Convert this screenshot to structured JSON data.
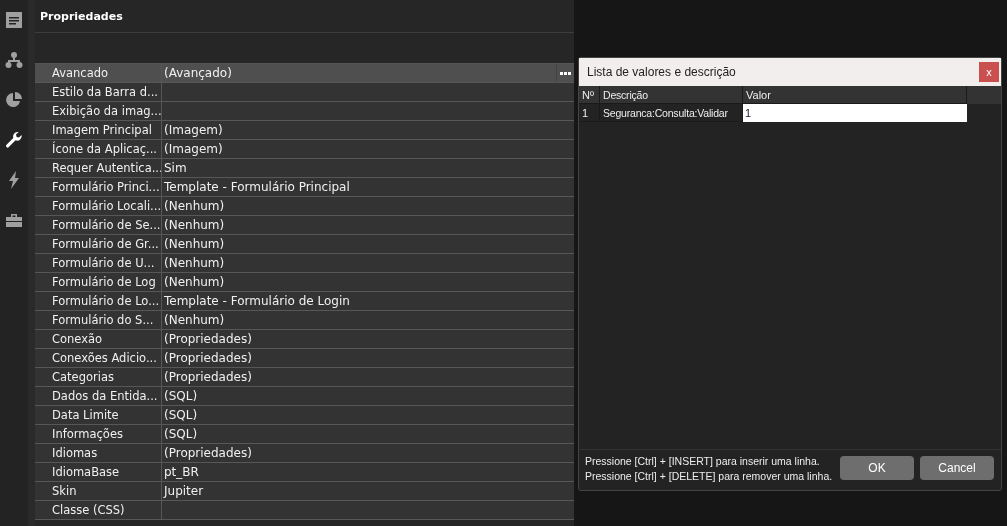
{
  "sidebar": {
    "items": [
      {
        "kind": "form",
        "selected": false
      },
      {
        "kind": "hierarchy",
        "selected": false
      },
      {
        "kind": "chart",
        "selected": false
      },
      {
        "kind": "wrench",
        "selected": true
      },
      {
        "kind": "lightning",
        "selected": false
      },
      {
        "kind": "toolbox",
        "selected": false
      }
    ]
  },
  "properties": {
    "title": "Propriedades",
    "rows": [
      {
        "name": "Avancado",
        "value": "(Avançado)",
        "selected": true
      },
      {
        "name": "Estilo da Barra d...",
        "selected": false
      },
      {
        "name": "Exibição da imag...",
        "selected": false
      },
      {
        "name": "Imagem Principal",
        "value": "(Imagem)",
        "selected": false
      },
      {
        "name": "Ícone da Aplicaç...",
        "value": "(Imagem)",
        "selected": false
      },
      {
        "name": "Requer Autentica...",
        "value": "Sim",
        "selected": false
      },
      {
        "name": "Formulário Princi...",
        "value": "Template - Formulário Principal",
        "selected": false
      },
      {
        "name": "Formulário Locali...",
        "value": "(Nenhum)",
        "selected": false
      },
      {
        "name": "Formulário de Se...",
        "value": "(Nenhum)",
        "selected": false
      },
      {
        "name": "Formulário de Gr...",
        "value": "(Nenhum)",
        "selected": false
      },
      {
        "name": "Formulário de U...",
        "value": "(Nenhum)",
        "selected": false
      },
      {
        "name": "Formulário de Log",
        "value": "(Nenhum)",
        "selected": false
      },
      {
        "name": "Formulário de Lo...",
        "value": "Template - Formulário de Login",
        "selected": false
      },
      {
        "name": "Formulário do S...",
        "value": "(Nenhum)",
        "selected": false
      },
      {
        "name": "Conexão",
        "value": "(Propriedades)",
        "selected": false
      },
      {
        "name": "Conexões Adicio...",
        "value": "(Propriedades)",
        "selected": false
      },
      {
        "name": "Categorias",
        "value": "(Propriedades)",
        "selected": false
      },
      {
        "name": "Dados da Entida...",
        "value": "(SQL)",
        "selected": false
      },
      {
        "name": "Data Limite",
        "value": "(SQL)",
        "selected": false
      },
      {
        "name": "Informações",
        "value": "(SQL)",
        "selected": false
      },
      {
        "name": "Idiomas",
        "value": "(Propriedades)",
        "selected": false
      },
      {
        "name": "IdiomaBase",
        "value": "pt_BR",
        "selected": false
      },
      {
        "name": "Skin",
        "value": "Jupiter",
        "selected": false
      },
      {
        "name": "Classe (CSS)",
        "selected": false
      }
    ]
  },
  "dialog": {
    "title": "Lista de valores e descrição",
    "close": "x",
    "columns": [
      "Nº",
      "Descrição",
      "Valor"
    ],
    "rows": [
      {
        "number": "1",
        "description": "Seguranca:Consulta:Validar",
        "value": "1"
      }
    ],
    "hints": [
      "Pressione [Ctrl] + [INSERT] para inserir uma linha.",
      "Pressione [Ctrl] + [DELETE] para remover uma linha."
    ],
    "buttons": [
      "OK",
      "Cancel"
    ]
  }
}
